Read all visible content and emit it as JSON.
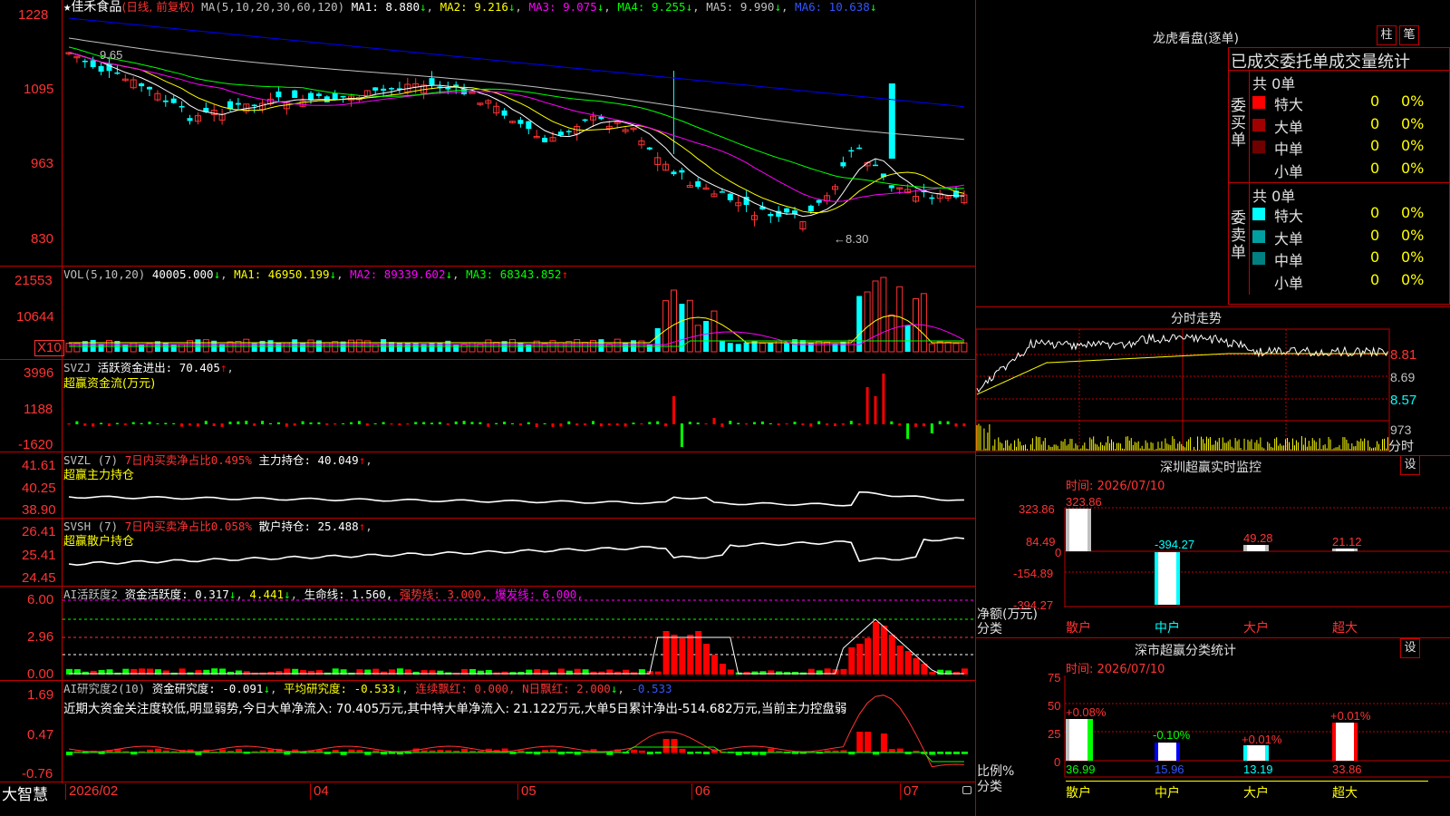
{
  "app": {
    "brand": "大智慧"
  },
  "k": {
    "title_star": "★",
    "stock": "佳禾食品",
    "period": "(日线, 前复权)",
    "ma_label": "MA(5,10,20,30,60,120)",
    "ma1": "MA1: 8.880",
    "ma2": "MA2: 9.216",
    "ma3": "MA3: 9.075",
    "ma4": "MA4: 9.255",
    "ma5": "MA5: 9.990",
    "ma6": "MA6: 10.638",
    "yticks": [
      "1228",
      "1095",
      "963",
      "830"
    ],
    "high_mark": "9.65",
    "low_mark": "8.30",
    "colors": {
      "ma1": "#ffffff",
      "ma2": "#ffff00",
      "ma3": "#ff00ff",
      "ma4": "#00ff00",
      "ma5": "#c0c0c0",
      "ma6": "#0000ff"
    }
  },
  "vol": {
    "label": "VOL(5,10,20)",
    "val": "40005.000",
    "ma1": "MA1: 46950.199",
    "ma2": "MA2: 89339.602",
    "ma3": "MA3: 68343.852",
    "yticks": [
      "21553",
      "10644"
    ],
    "unit": "X10"
  },
  "svzj": {
    "label": "SVZJ",
    "title": "活跃资金进出: 70.405",
    "sub": "超赢资金流(万元)",
    "yticks": [
      "3996",
      "1188",
      "-1620"
    ]
  },
  "svzl": {
    "label": "SVZL (7)",
    "t1": "7日内买卖净占比0.495%",
    "t2": "主力持仓: 40.049",
    "sub": "超赢主力持仓",
    "yticks": [
      "41.61",
      "40.25",
      "38.90"
    ]
  },
  "svsh": {
    "label": "SVSH (7)",
    "t1": "7日内买卖净占比0.058%",
    "t2": "散户持仓: 25.488",
    "sub": "超赢散户持仓",
    "yticks": [
      "26.41",
      "25.41",
      "24.45"
    ]
  },
  "ai1": {
    "label": "AI活跃度2",
    "t1": "资金活跃度: 0.317",
    "t2": "4.441",
    "t3": "生命线: 1.560,",
    "t4": "强势线: 3.000,",
    "t5": "爆发线: 6.000,",
    "yticks": [
      "6.00",
      "2.96",
      "0.00"
    ]
  },
  "ai2": {
    "label": "AI研究度2(10)",
    "t1": "资金研究度: -0.091",
    "t2": "平均研究度: -0.533",
    "t3": "连续飘红: 0.000,",
    "t4": "N日飘红: 2.000",
    "t5": "-0.533",
    "msg": "近期大资金关注度较低,明显弱势,今日大单净流入: 70.405万元,其中特大单净流入: 21.122万元,大单5日累计净出-514.682万元,当前主力控盘弱",
    "yticks": [
      "1.69",
      "0.47",
      "-0.76"
    ]
  },
  "xaxis": [
    "2026/02",
    "04",
    "05",
    "06",
    "07"
  ],
  "lhb": {
    "title": "龙虎看盘(逐单)",
    "btn1": "柱",
    "btn2": "笔",
    "header": "已成交委托单成交量统计",
    "buy": {
      "side": "委买单",
      "total": "共 0单",
      "rows": [
        {
          "name": "特大",
          "cnt": "0",
          "pct": "0%",
          "color": "#ff0000"
        },
        {
          "name": "大单",
          "cnt": "0",
          "pct": "0%",
          "color": "#a00000"
        },
        {
          "name": "中单",
          "cnt": "0",
          "pct": "0%",
          "color": "#700000"
        },
        {
          "name": "小单",
          "cnt": "0",
          "pct": "0%",
          "color": "#000000"
        }
      ]
    },
    "sell": {
      "side": "委卖单",
      "total": "共 0单",
      "rows": [
        {
          "name": "特大",
          "cnt": "0",
          "pct": "0%",
          "color": "#00ffff"
        },
        {
          "name": "大单",
          "cnt": "0",
          "pct": "0%",
          "color": "#00a0a0"
        },
        {
          "name": "中单",
          "cnt": "0",
          "pct": "0%",
          "color": "#008080"
        },
        {
          "name": "小单",
          "cnt": "0",
          "pct": "0%",
          "color": "#000000"
        }
      ]
    }
  },
  "fs": {
    "title": "分时走势",
    "yticks": [
      "8.81",
      "8.69",
      "8.57"
    ],
    "vol": "973",
    "unit": "分时"
  },
  "szjk": {
    "title": "深圳超赢实时监控",
    "btn": "设",
    "time": "时间: 2026/07/10",
    "yticks": [
      "323.86",
      "84.49",
      "0",
      "-154.89",
      "-394.27"
    ],
    "ylabel": "净额(万元)",
    "cat_label": "分类",
    "cats": [
      "散户",
      "中户",
      "大户",
      "超大"
    ],
    "vals": [
      "323.86",
      "-394.27",
      "49.28",
      "21.12"
    ]
  },
  "fltj": {
    "title": "深市超赢分类统计",
    "btn": "设",
    "time": "时间: 2026/07/10",
    "yticks": [
      "75",
      "50",
      "25",
      "0"
    ],
    "pcts": [
      "+0.08%",
      "-0.10%",
      "+0.01%",
      "+0.01%"
    ],
    "vals": [
      "36.99",
      "15.96",
      "13.19",
      "33.86"
    ],
    "cats": [
      "散户",
      "中户",
      "大户",
      "超大"
    ],
    "ylabel": "比例%",
    "cat_label": "分类"
  }
}
